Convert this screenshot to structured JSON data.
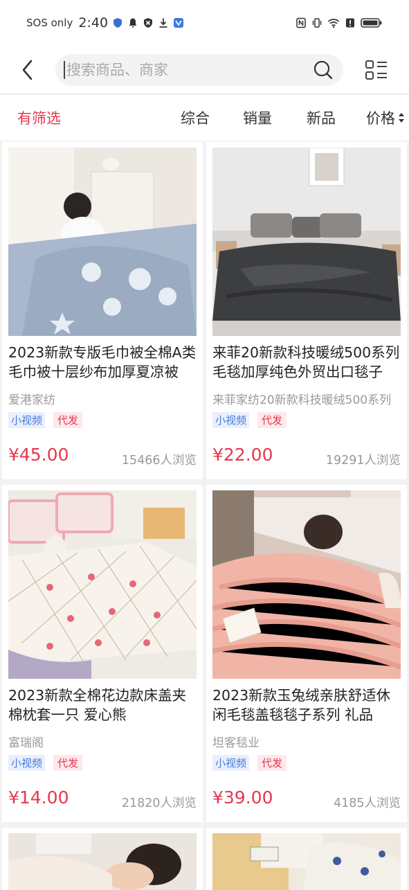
{
  "status_bar": {
    "network": "SOS only",
    "time": "2:40"
  },
  "search": {
    "placeholder": "搜索商品、商家"
  },
  "filter": {
    "active_label": "有筛选",
    "sort_tabs": [
      "综合",
      "销量",
      "新品"
    ],
    "price_label": "价格"
  },
  "products": [
    {
      "title": "2023新款专版毛巾被全棉A类毛巾被十层纱布加厚夏凉被",
      "shop": "爱港家纺",
      "tag_video": "小视频",
      "tag_drop": "代发",
      "price": "¥45.00",
      "views": "15466人浏览"
    },
    {
      "title": "来菲20新款科技暖绒500系列毛毯加厚纯色外贸出口毯子",
      "shop": "来菲家纺20新款科技暖绒500系列",
      "tag_video": "小视频",
      "tag_drop": "代发",
      "price": "¥22.00",
      "views": "19291人浏览"
    },
    {
      "title": "2023新款全棉花边款床盖夹棉枕套一只 爱心熊",
      "shop": "富瑞阁",
      "tag_video": "小视频",
      "tag_drop": "代发",
      "price": "¥14.00",
      "views": "21820人浏览"
    },
    {
      "title": "2023新款玉兔绒亲肤舒适休闲毛毯盖毯毯子系列 礼品",
      "shop": "坦客毯业",
      "tag_video": "小视频",
      "tag_drop": "代发",
      "price": "¥39.00",
      "views": "4185人浏览"
    }
  ],
  "colors": {
    "accent": "#e5384f",
    "tag_video": "#4a78d6",
    "muted": "#999999"
  }
}
